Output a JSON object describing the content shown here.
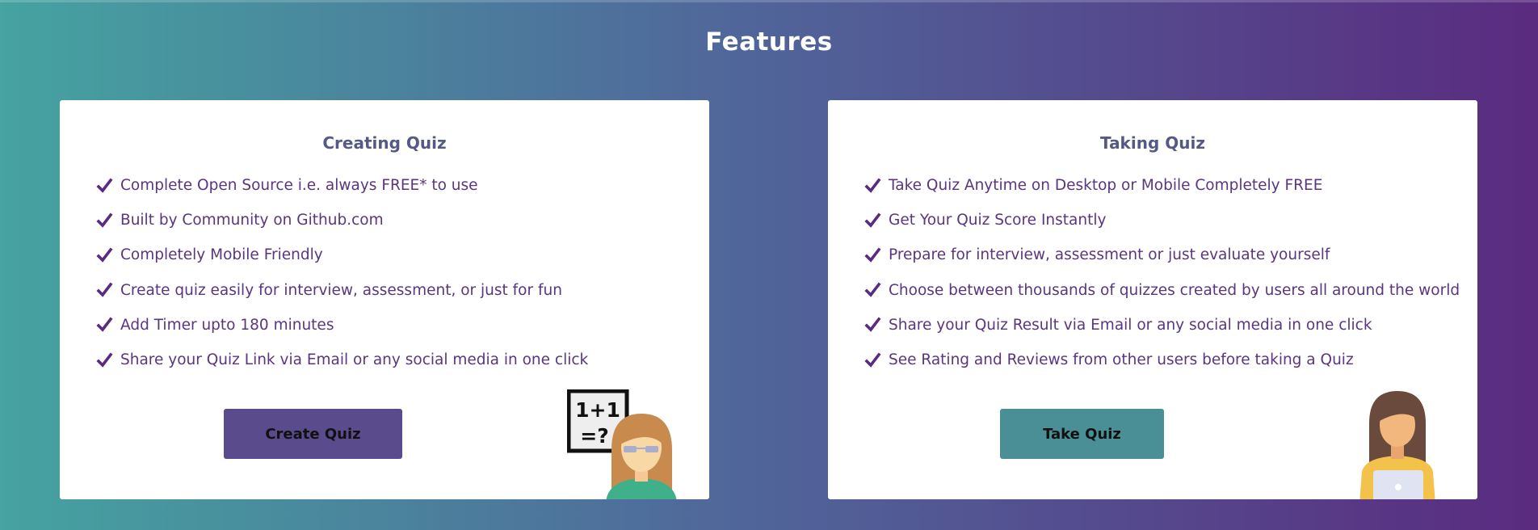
{
  "page": {
    "title": "Features",
    "colors": {
      "gradient_start": "#45a3a0",
      "gradient_mid": "#50669a",
      "gradient_end": "#5a2b80",
      "text_purple": "#5a3580",
      "card_title": "#555a85"
    }
  },
  "cards": {
    "creating": {
      "title": "Creating Quiz",
      "features": [
        "Complete Open Source i.e. always FREE* to use",
        "Built by Community on Github.com",
        "Completely Mobile Friendly",
        "Create quiz easily for interview, assessment, or just for fun",
        "Add Timer upto 180 minutes",
        "Share your Quiz Link via Email or any social media in one click"
      ],
      "button_label": "Create Quiz",
      "button_color": "#5a4c8c",
      "illustration": "teacher-with-math-board-icon",
      "board_text": [
        "1+1",
        "=?"
      ]
    },
    "taking": {
      "title": "Taking Quiz",
      "features": [
        "Take Quiz Anytime on Desktop or Mobile Completely FREE",
        "Get Your Quiz Score Instantly",
        "Prepare for interview, assessment or just evaluate yourself",
        "Choose between thousands of quizzes created by users all around the world",
        "Share your Quiz Result via Email or any social media in one click",
        "See Rating and Reviews from other users before taking a Quiz"
      ],
      "button_label": "Take Quiz",
      "button_color": "#4a8f96",
      "illustration": "student-with-laptop-icon"
    }
  }
}
